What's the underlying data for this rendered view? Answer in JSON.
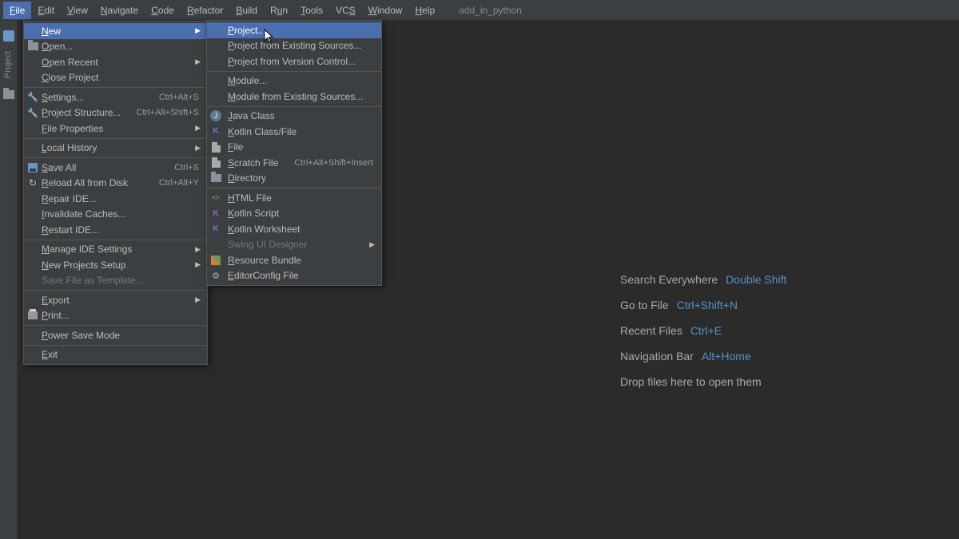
{
  "menubar": {
    "items": [
      {
        "label": "File",
        "u": "F"
      },
      {
        "label": "Edit",
        "u": "E"
      },
      {
        "label": "View",
        "u": "V"
      },
      {
        "label": "Navigate",
        "u": "N"
      },
      {
        "label": "Code",
        "u": "C"
      },
      {
        "label": "Refactor",
        "u": "R"
      },
      {
        "label": "Build",
        "u": "B"
      },
      {
        "label": "Run",
        "u": "u"
      },
      {
        "label": "Tools",
        "u": "T"
      },
      {
        "label": "VCS",
        "u": "S"
      },
      {
        "label": "Window",
        "u": "W"
      },
      {
        "label": "Help",
        "u": "H"
      }
    ],
    "project_name": "add_in_python"
  },
  "left_tool": {
    "label": "Project"
  },
  "file_menu": {
    "items": [
      {
        "label": "New",
        "arrow": true,
        "highlighted": true
      },
      {
        "label": "Open...",
        "icon": "folder"
      },
      {
        "label": "Open Recent",
        "arrow": true
      },
      {
        "label": "Close Project"
      },
      {
        "sep": true
      },
      {
        "label": "Settings...",
        "icon": "wrench",
        "shortcut": "Ctrl+Alt+S"
      },
      {
        "label": "Project Structure...",
        "icon": "wrench",
        "shortcut": "Ctrl+Alt+Shift+S"
      },
      {
        "label": "File Properties",
        "arrow": true
      },
      {
        "sep": true
      },
      {
        "label": "Local History",
        "arrow": true
      },
      {
        "sep": true
      },
      {
        "label": "Save All",
        "icon": "disk",
        "shortcut": "Ctrl+S"
      },
      {
        "label": "Reload All from Disk",
        "icon": "reload",
        "shortcut": "Ctrl+Alt+Y"
      },
      {
        "label": "Repair IDE..."
      },
      {
        "label": "Invalidate Caches..."
      },
      {
        "label": "Restart IDE..."
      },
      {
        "sep": true
      },
      {
        "label": "Manage IDE Settings",
        "arrow": true
      },
      {
        "label": "New Projects Setup",
        "arrow": true
      },
      {
        "label": "Save File as Template...",
        "disabled": true
      },
      {
        "sep": true
      },
      {
        "label": "Export",
        "arrow": true
      },
      {
        "label": "Print...",
        "icon": "print"
      },
      {
        "sep": true
      },
      {
        "label": "Power Save Mode"
      },
      {
        "sep": true
      },
      {
        "label": "Exit"
      }
    ]
  },
  "new_submenu": {
    "items": [
      {
        "label": "Project...",
        "highlighted": true
      },
      {
        "label": "Project from Existing Sources..."
      },
      {
        "label": "Project from Version Control..."
      },
      {
        "sep": true
      },
      {
        "label": "Module..."
      },
      {
        "label": "Module from Existing Sources..."
      },
      {
        "sep": true
      },
      {
        "label": "Java Class",
        "icon": "java"
      },
      {
        "label": "Kotlin Class/File",
        "icon": "kotlin"
      },
      {
        "label": "File",
        "icon": "file"
      },
      {
        "label": "Scratch File",
        "icon": "file",
        "shortcut": "Ctrl+Alt+Shift+Insert"
      },
      {
        "label": "Directory",
        "icon": "folder"
      },
      {
        "sep": true
      },
      {
        "label": "HTML File",
        "icon": "html"
      },
      {
        "label": "Kotlin Script",
        "icon": "ks"
      },
      {
        "label": "Kotlin Worksheet",
        "icon": "ks"
      },
      {
        "label": "Swing UI Designer",
        "arrow": true,
        "disabled": true
      },
      {
        "label": "Resource Bundle",
        "icon": "bundle"
      },
      {
        "label": "EditorConfig File",
        "icon": "gear"
      }
    ]
  },
  "welcome": {
    "rows": [
      {
        "label": "Search Everywhere",
        "shortcut": "Double Shift"
      },
      {
        "label": "Go to File",
        "shortcut": "Ctrl+Shift+N"
      },
      {
        "label": "Recent Files",
        "shortcut": "Ctrl+E"
      },
      {
        "label": "Navigation Bar",
        "shortcut": "Alt+Home"
      },
      {
        "label": "Drop files here to open them",
        "shortcut": ""
      }
    ]
  }
}
